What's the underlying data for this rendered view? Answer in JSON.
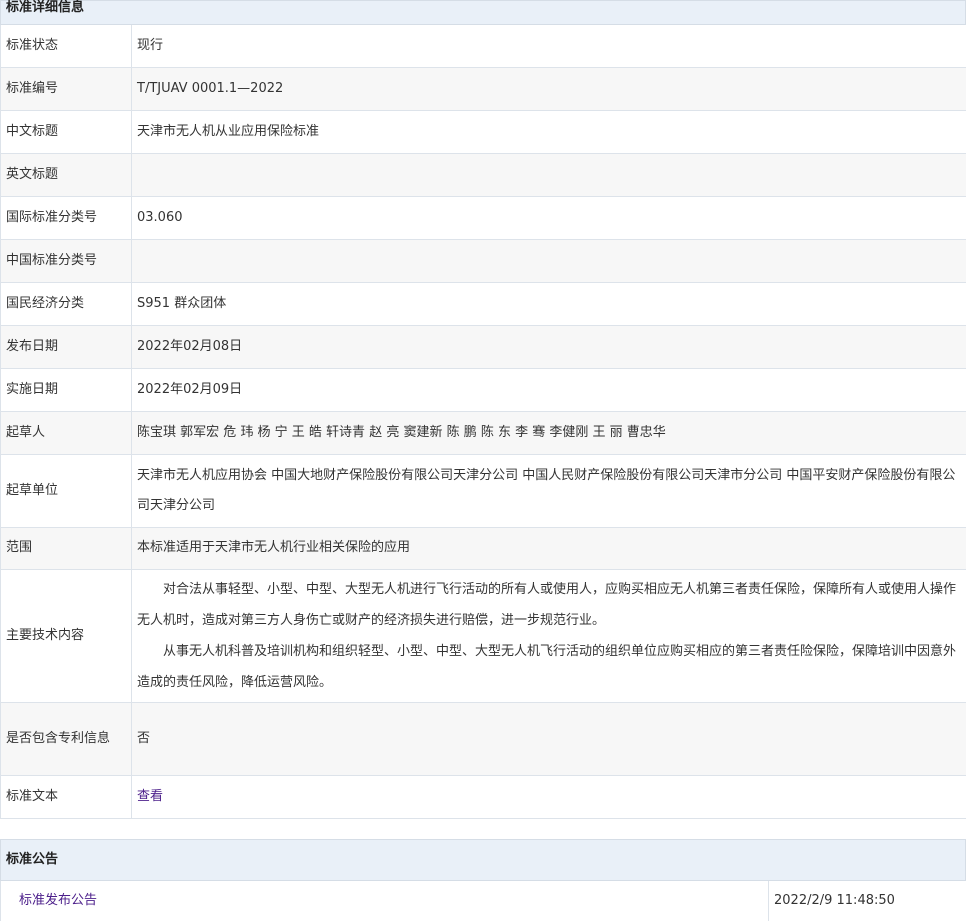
{
  "detail": {
    "header": "标准详细信息",
    "rows": [
      {
        "label": "标准状态",
        "value": "现行"
      },
      {
        "label": "标准编号",
        "value": "T/TJUAV 0001.1—2022"
      },
      {
        "label": "中文标题",
        "value": "天津市无人机从业应用保险标准"
      },
      {
        "label": "英文标题",
        "value": ""
      },
      {
        "label": "国际标准分类号",
        "value": "03.060"
      },
      {
        "label": "中国标准分类号",
        "value": ""
      },
      {
        "label": "国民经济分类",
        "value": "S951 群众团体"
      },
      {
        "label": "发布日期",
        "value": "2022年02月08日"
      },
      {
        "label": "实施日期",
        "value": "2022年02月09日"
      },
      {
        "label": "起草人",
        "value": "陈宝琪 郭军宏 危 玮 杨 宁 王 皓 轩诗青 赵 亮 窦建新 陈 鹏 陈 东 李 骞 李健刚 王 丽 曹忠华"
      },
      {
        "label": "起草单位",
        "value": "天津市无人机应用协会 中国大地财产保险股份有限公司天津分公司 中国人民财产保险股份有限公司天津市分公司 中国平安财产保险股份有限公司天津分公司"
      },
      {
        "label": "范围",
        "value": "本标准适用于天津市无人机行业相关保险的应用"
      },
      {
        "label": "主要技术内容",
        "paragraphs": [
          "对合法从事轻型、小型、中型、大型无人机进行飞行活动的所有人或使用人，应购买相应无人机第三者责任保险，保障所有人或使用人操作无人机时，造成对第三方人身伤亡或财产的经济损失进行赔偿，进一步规范行业。",
          "从事无人机科普及培训机构和组织轻型、小型、中型、大型无人机飞行活动的组织单位应购买相应的第三者责任险保险，保障培训中因意外造成的责任风险，降低运营风险。"
        ]
      },
      {
        "label": "是否包含专利信息",
        "value": "否"
      },
      {
        "label": "标准文本",
        "link": "查看"
      }
    ]
  },
  "notice": {
    "header": "标准公告",
    "items": [
      {
        "title": "标准发布公告",
        "time": "2022/2/9 11:48:50"
      }
    ]
  },
  "colors": {
    "header_bg": "#e9f0f8",
    "row_alt_bg": "#f7f7f7",
    "link": "#4b1e8a",
    "border": "#dde3ea"
  }
}
